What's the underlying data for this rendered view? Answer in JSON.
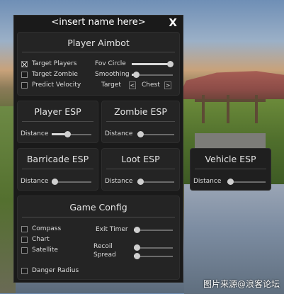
{
  "window": {
    "title": "<insert name here>",
    "close_label": "X"
  },
  "aimbot": {
    "title": "Player Aimbot",
    "target_players": {
      "label": "Target Players",
      "checked": true
    },
    "target_zombie": {
      "label": "Target Zombie",
      "checked": false
    },
    "predict_velocity": {
      "label": "Predict Velocity",
      "checked": false
    },
    "fov_circle": {
      "label": "Fov Circle",
      "value": 0.95
    },
    "smoothing": {
      "label": "Smoothing",
      "value": 0.1
    },
    "target": {
      "label": "Target",
      "value": "Chest",
      "prev": "<",
      "next": ">"
    }
  },
  "player_esp": {
    "title": "Player ESP",
    "distance_label": "Distance",
    "distance_value": 0.4
  },
  "zombie_esp": {
    "title": "Zombie ESP",
    "distance_label": "Distance",
    "distance_value": 0.05
  },
  "barricade_esp": {
    "title": "Barricade ESP",
    "distance_label": "Distance",
    "distance_value": 0.05
  },
  "loot_esp": {
    "title": "Loot ESP",
    "distance_label": "Distance",
    "distance_value": 0.05
  },
  "vehicle_esp": {
    "title": "Vehicle ESP",
    "distance_label": "Distance",
    "distance_value": 0.05
  },
  "game_config": {
    "title": "Game Config",
    "compass": {
      "label": "Compass",
      "checked": false
    },
    "chart": {
      "label": "Chart",
      "checked": false
    },
    "satellite": {
      "label": "Satellite",
      "checked": false
    },
    "danger_radius": {
      "label": "Danger Radius",
      "checked": false
    },
    "exit_timer": {
      "label": "Exit Timer",
      "value": 0.05
    },
    "recoil": {
      "label": "Recoil",
      "value": 0.05
    },
    "spread": {
      "label": "Spread",
      "value": 0.05
    }
  },
  "watermark": "图片来源@浪客论坛"
}
